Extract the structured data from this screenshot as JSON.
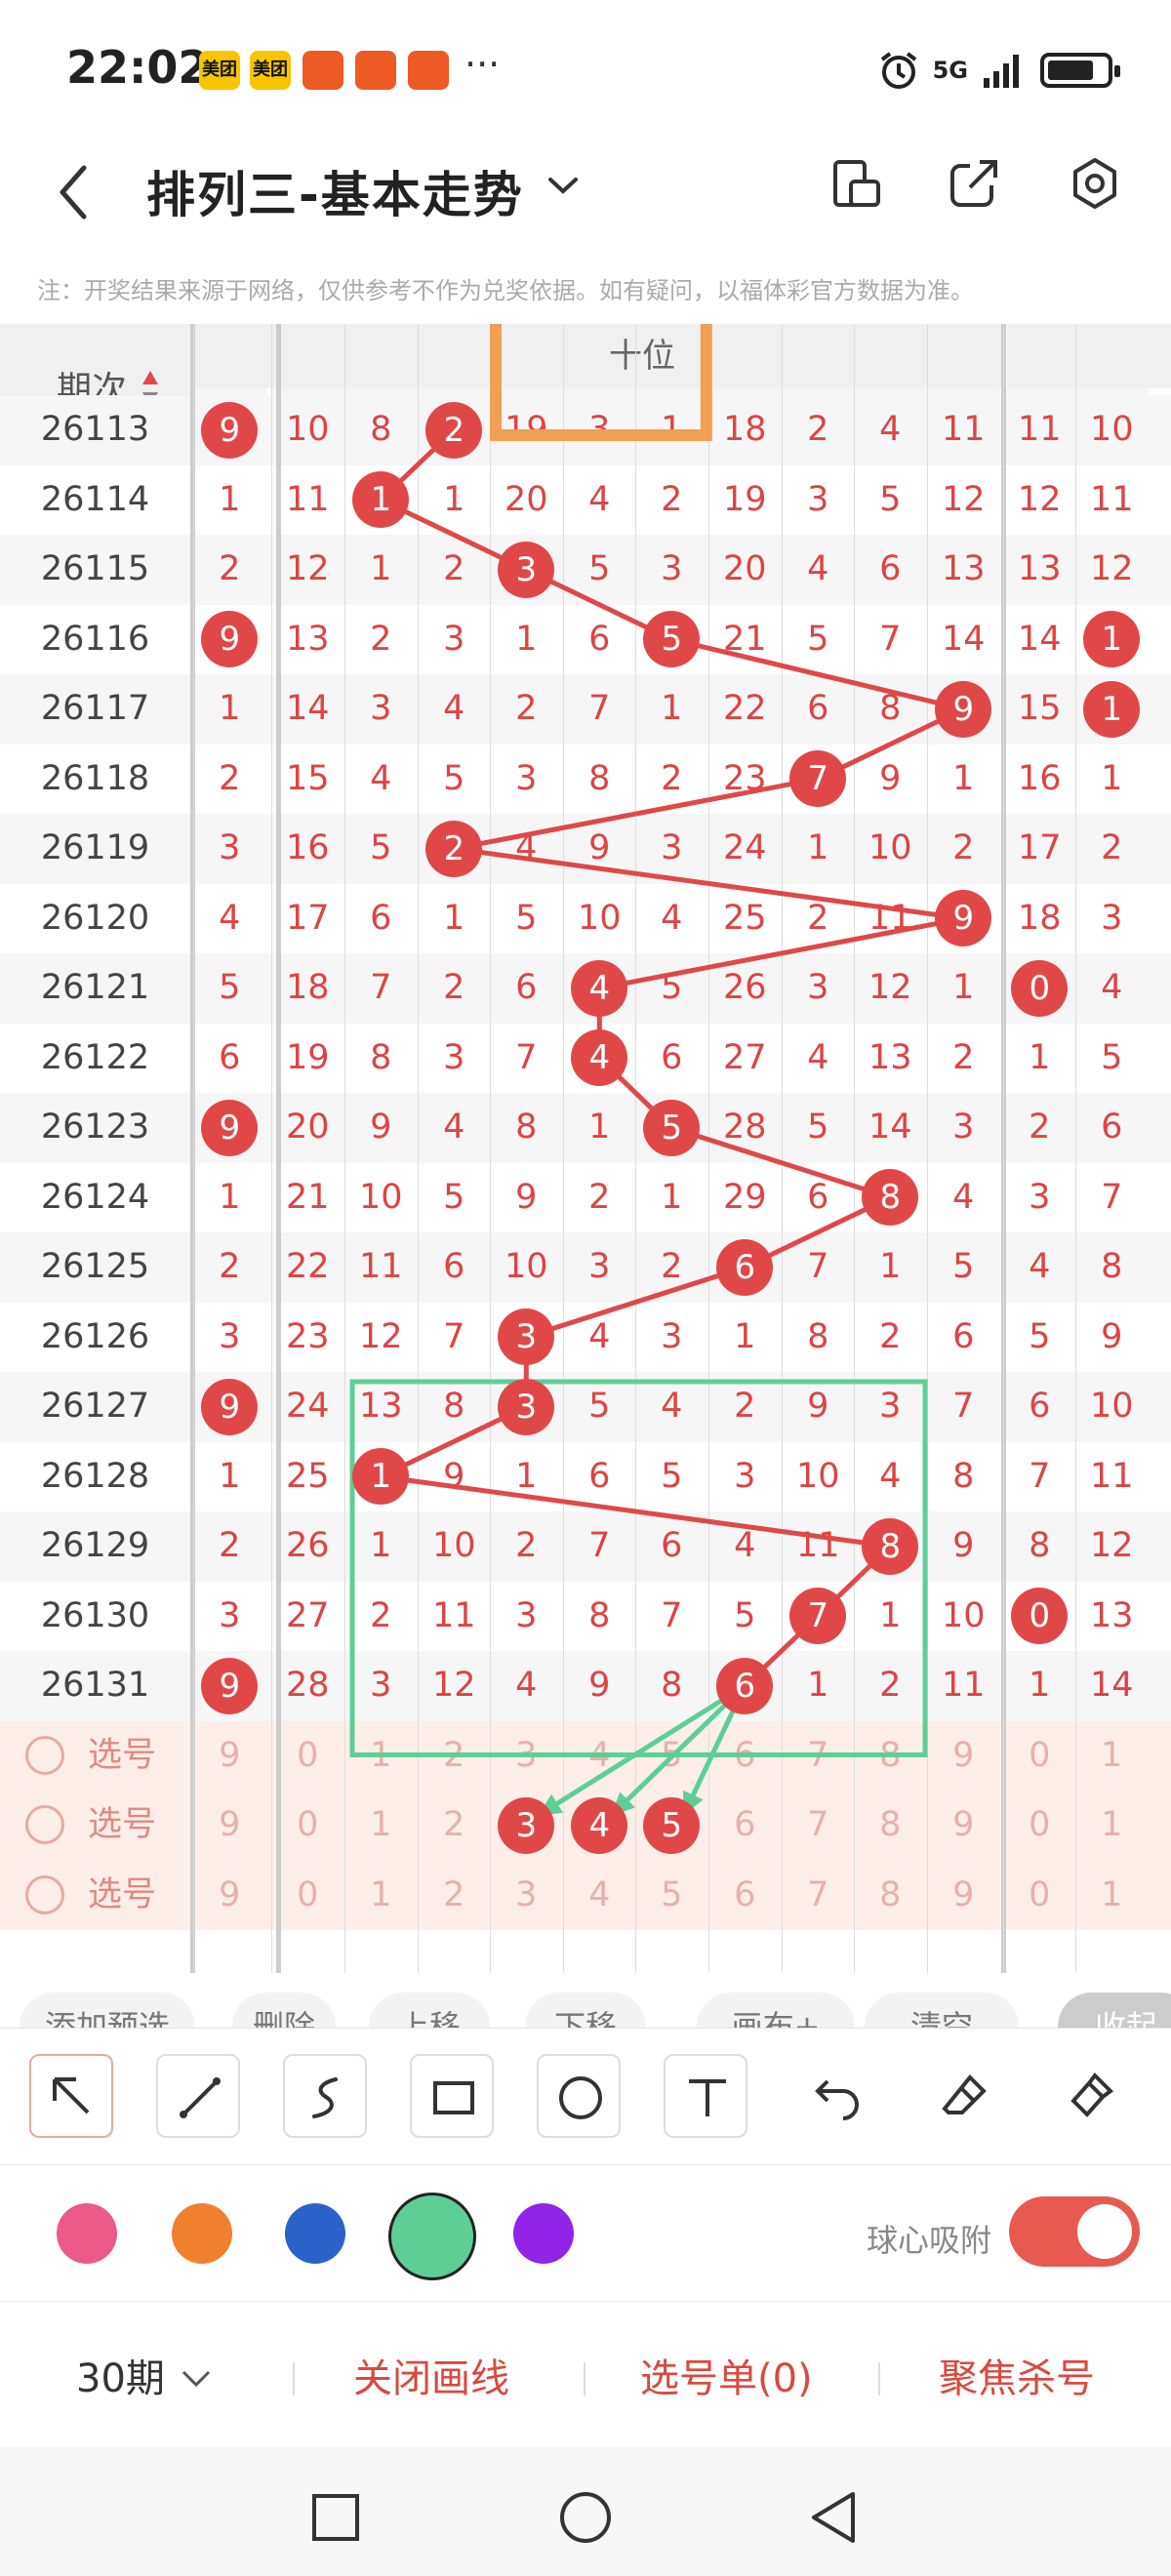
{
  "status": {
    "time": "22:02",
    "network": "5G",
    "app_icons": [
      "美团",
      "美团",
      "",
      "",
      ""
    ],
    "more": "···"
  },
  "header": {
    "title": "排列三-基本走势"
  },
  "notice": "注：开奖结果来源于网络，仅供参考不作为兑奖依据。如有疑问，以福体彩官方数据为准。",
  "table": {
    "period_header": "期次",
    "group_header": "十位",
    "col_headers": [
      "9",
      "0",
      "1",
      "2",
      "3",
      "4",
      "5",
      "6",
      "7",
      "8",
      "9",
      "0",
      "1"
    ],
    "rows": [
      {
        "period": "26113",
        "cells": [
          "9",
          "10",
          "8",
          "2",
          "19",
          "3",
          "1",
          "18",
          "2",
          "4",
          "11",
          "11",
          "10"
        ],
        "ball": [
          0,
          3
        ]
      },
      {
        "period": "26114",
        "cells": [
          "1",
          "11",
          "1",
          "1",
          "20",
          "4",
          "2",
          "19",
          "3",
          "5",
          "12",
          "12",
          "11"
        ],
        "ball": [
          2
        ]
      },
      {
        "period": "26115",
        "cells": [
          "2",
          "12",
          "1",
          "2",
          "3",
          "5",
          "3",
          "20",
          "4",
          "6",
          "13",
          "13",
          "12"
        ],
        "ball": [
          4
        ]
      },
      {
        "period": "26116",
        "cells": [
          "9",
          "13",
          "2",
          "3",
          "1",
          "6",
          "5",
          "21",
          "5",
          "7",
          "14",
          "14",
          "1"
        ],
        "ball": [
          0,
          6,
          12
        ]
      },
      {
        "period": "26117",
        "cells": [
          "1",
          "14",
          "3",
          "4",
          "2",
          "7",
          "1",
          "22",
          "6",
          "8",
          "9",
          "15",
          "1"
        ],
        "ball": [
          10,
          12
        ]
      },
      {
        "period": "26118",
        "cells": [
          "2",
          "15",
          "4",
          "5",
          "3",
          "8",
          "2",
          "23",
          "7",
          "9",
          "1",
          "16",
          "1"
        ],
        "ball": [
          8
        ]
      },
      {
        "period": "26119",
        "cells": [
          "3",
          "16",
          "5",
          "2",
          "4",
          "9",
          "3",
          "24",
          "1",
          "10",
          "2",
          "17",
          "2"
        ],
        "ball": [
          3
        ]
      },
      {
        "period": "26120",
        "cells": [
          "4",
          "17",
          "6",
          "1",
          "5",
          "10",
          "4",
          "25",
          "2",
          "11",
          "9",
          "18",
          "3"
        ],
        "ball": [
          10
        ]
      },
      {
        "period": "26121",
        "cells": [
          "5",
          "18",
          "7",
          "2",
          "6",
          "4",
          "5",
          "26",
          "3",
          "12",
          "1",
          "0",
          "4"
        ],
        "ball": [
          5,
          11
        ]
      },
      {
        "period": "26122",
        "cells": [
          "6",
          "19",
          "8",
          "3",
          "7",
          "4",
          "6",
          "27",
          "4",
          "13",
          "2",
          "1",
          "5"
        ],
        "ball": [
          5
        ]
      },
      {
        "period": "26123",
        "cells": [
          "9",
          "20",
          "9",
          "4",
          "8",
          "1",
          "5",
          "28",
          "5",
          "14",
          "3",
          "2",
          "6"
        ],
        "ball": [
          0,
          6
        ]
      },
      {
        "period": "26124",
        "cells": [
          "1",
          "21",
          "10",
          "5",
          "9",
          "2",
          "1",
          "29",
          "6",
          "8",
          "4",
          "3",
          "7"
        ],
        "ball": [
          9
        ]
      },
      {
        "period": "26125",
        "cells": [
          "2",
          "22",
          "11",
          "6",
          "10",
          "3",
          "2",
          "6",
          "7",
          "1",
          "5",
          "4",
          "8"
        ],
        "ball": [
          7
        ]
      },
      {
        "period": "26126",
        "cells": [
          "3",
          "23",
          "12",
          "7",
          "3",
          "4",
          "3",
          "1",
          "8",
          "2",
          "6",
          "5",
          "9"
        ],
        "ball": [
          4
        ]
      },
      {
        "period": "26127",
        "cells": [
          "9",
          "24",
          "13",
          "8",
          "3",
          "5",
          "4",
          "2",
          "9",
          "3",
          "7",
          "6",
          "10"
        ],
        "ball": [
          0,
          4
        ]
      },
      {
        "period": "26128",
        "cells": [
          "1",
          "25",
          "1",
          "9",
          "1",
          "6",
          "5",
          "3",
          "10",
          "4",
          "8",
          "7",
          "11"
        ],
        "ball": [
          2
        ]
      },
      {
        "period": "26129",
        "cells": [
          "2",
          "26",
          "1",
          "10",
          "2",
          "7",
          "6",
          "4",
          "11",
          "8",
          "9",
          "8",
          "12"
        ],
        "ball": [
          9
        ]
      },
      {
        "period": "26130",
        "cells": [
          "3",
          "27",
          "2",
          "11",
          "3",
          "8",
          "7",
          "5",
          "7",
          "1",
          "10",
          "0",
          "13"
        ],
        "ball": [
          8,
          11
        ]
      },
      {
        "period": "26131",
        "cells": [
          "9",
          "28",
          "3",
          "12",
          "4",
          "9",
          "8",
          "6",
          "1",
          "2",
          "11",
          "1",
          "14"
        ],
        "ball": [
          0,
          7
        ]
      }
    ],
    "pick_rows": [
      {
        "label": "选号",
        "cells": [
          "9",
          "0",
          "1",
          "2",
          "3",
          "4",
          "5",
          "6",
          "7",
          "8",
          "9",
          "0",
          "1"
        ],
        "ball": []
      },
      {
        "label": "选号",
        "cells": [
          "9",
          "0",
          "1",
          "2",
          "3",
          "4",
          "5",
          "6",
          "7",
          "8",
          "9",
          "0",
          "1"
        ],
        "ball": [
          4,
          5,
          6
        ]
      },
      {
        "label": "选号",
        "cells": [
          "9",
          "0",
          "1",
          "2",
          "3",
          "4",
          "5",
          "6",
          "7",
          "8",
          "9",
          "0",
          "1"
        ],
        "ball": []
      }
    ]
  },
  "action_chips": [
    "添加预选",
    "删除",
    "上移",
    "下移",
    "画布+",
    "清空",
    "收起"
  ],
  "tools": [
    "pointer-icon",
    "line-icon",
    "curve-icon",
    "rectangle-icon",
    "circle-icon",
    "text-icon",
    "undo-icon",
    "eraser-icon",
    "clear-brush-icon"
  ],
  "palette": {
    "colors": [
      "#ec5a8a",
      "#f07f2e",
      "#2b62c9",
      "#5dcf96",
      "#9124e6"
    ],
    "selected": 3,
    "snap_label": "球心吸附",
    "snap_on": true
  },
  "bottom": {
    "period_select": "30期",
    "close_lines": "关闭画线",
    "pick_list": "选号单(0)",
    "focus_kill": "聚焦杀号"
  },
  "colors": {
    "accent": "#e04848",
    "highlight_orange": "#f0a050",
    "highlight_green": "#5dcf96"
  }
}
